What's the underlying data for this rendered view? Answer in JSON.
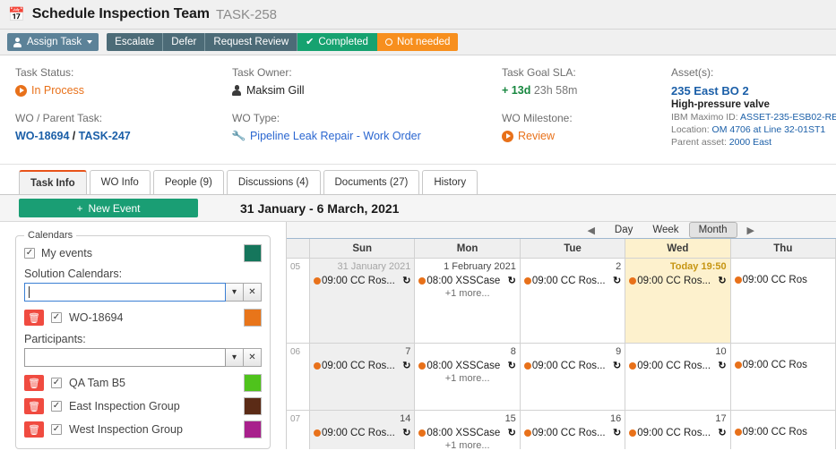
{
  "titlebar": {
    "icon": "calendar-icon",
    "title": "Schedule Inspection Team",
    "code": "TASK-258"
  },
  "toolbar": {
    "assign_label": "Assign Task",
    "buttons": [
      {
        "label": "Escalate",
        "style": "dark"
      },
      {
        "label": "Defer",
        "style": "dark"
      },
      {
        "label": "Request Review",
        "style": "dark"
      },
      {
        "label": "Completed",
        "style": "completed",
        "icon": "check-icon"
      },
      {
        "label": "Not needed",
        "style": "notneeded",
        "icon": "circle-icon"
      }
    ]
  },
  "info": {
    "task_status_label": "Task Status:",
    "task_status_value": "In Process",
    "wo_parent_label": "WO / Parent Task:",
    "wo_link": "WO-18694",
    "wo_sep": "/",
    "parent_link": "TASK-247",
    "task_owner_label": "Task Owner:",
    "task_owner_value": "Maksim Gill",
    "wo_type_label": "WO Type:",
    "wo_type_value": "Pipeline Leak Repair - Work Order",
    "sla_label": "Task Goal SLA:",
    "sla_plus": "+",
    "sla_days": "13d",
    "sla_rest": "23h 58m",
    "milestone_label": "WO Milestone:",
    "milestone_value": "Review",
    "assets_label": "Asset(s):",
    "asset_name": "235 East BO 2",
    "asset_desc": "High-pressure valve",
    "maximo_prefix": "IBM Maximo ID:",
    "maximo_id": "ASSET-235-ESB02-RE",
    "location_prefix": "Location:",
    "location_value": "OM 4706 at Line 32-01ST1",
    "parent_prefix": "Parent asset:",
    "parent_value": "2000 East"
  },
  "tabs": [
    {
      "label": "Task Info",
      "active": true
    },
    {
      "label": "WO Info",
      "active": false
    },
    {
      "label": "People (9)",
      "active": false
    },
    {
      "label": "Discussions (4)",
      "active": false
    },
    {
      "label": "Documents (27)",
      "active": false
    },
    {
      "label": "History",
      "active": false
    }
  ],
  "calbar": {
    "new_event_label": "New Event",
    "new_event_plus": "+",
    "date_range": "31 January - 6 March, 2021"
  },
  "sidebar": {
    "legend": "Calendars",
    "my_events_label": "My events",
    "my_events_checked": true,
    "my_events_color": "#15765c",
    "solution_label": "Solution Calendars:",
    "solution_value": "",
    "participants_label": "Participants:",
    "participants_value": "",
    "dropdown_glyph": "⌄",
    "clear_glyph": "✕",
    "trash_glyph": "Ὕ1",
    "calendars": [
      {
        "label": "WO-18694",
        "checked": true,
        "color": "#e8751a"
      }
    ],
    "participants": [
      {
        "label": "QA Tam B5",
        "checked": true,
        "color": "#4fc31c"
      },
      {
        "label": "East Inspection Group",
        "checked": true,
        "color": "#5b2b16"
      },
      {
        "label": "West Inspection Group",
        "checked": true,
        "color": "#a8208c"
      }
    ]
  },
  "calendar_nav": {
    "prev_glyph": "◀",
    "next_glyph": "▶",
    "views": [
      {
        "label": "Day",
        "selected": false
      },
      {
        "label": "Week",
        "selected": false
      },
      {
        "label": "Month",
        "selected": true
      }
    ]
  },
  "calendar": {
    "day_headers": [
      "Sun",
      "Mon",
      "Tue",
      "Wed",
      "Thu"
    ],
    "today_column_index": 3,
    "weeks": [
      {
        "week_number": "05",
        "days": [
          {
            "date_label": "31 January 2021",
            "muted": true,
            "weekend": true,
            "today": false,
            "events": [
              {
                "time": "09:00",
                "title": "CC Ros...",
                "recurring": true,
                "color": "#e8711a"
              }
            ],
            "more": null
          },
          {
            "date_label": "1 February 2021",
            "muted": false,
            "weekend": false,
            "today": false,
            "events": [
              {
                "time": "08:00",
                "title": "XSSCase",
                "recurring": true,
                "color": "#e8711a"
              }
            ],
            "more": "+1 more..."
          },
          {
            "date_label": "2",
            "muted": false,
            "weekend": false,
            "today": false,
            "events": [
              {
                "time": "09:00",
                "title": "CC Ros...",
                "recurring": true,
                "color": "#e8711a"
              }
            ],
            "more": null
          },
          {
            "date_label": "Today 19:50",
            "muted": false,
            "weekend": false,
            "today": true,
            "events": [
              {
                "time": "09:00",
                "title": "CC Ros...",
                "recurring": true,
                "color": "#e8711a"
              }
            ],
            "more": null
          },
          {
            "date_label": "",
            "muted": false,
            "weekend": false,
            "today": false,
            "events": [
              {
                "time": "09:00",
                "title": "CC Ros",
                "recurring": false,
                "color": "#e8711a"
              }
            ],
            "more": null
          }
        ]
      },
      {
        "week_number": "06",
        "days": [
          {
            "date_label": "7",
            "muted": false,
            "weekend": true,
            "today": false,
            "events": [
              {
                "time": "09:00",
                "title": "CC Ros...",
                "recurring": true,
                "color": "#e8711a"
              }
            ],
            "more": null
          },
          {
            "date_label": "8",
            "muted": false,
            "weekend": false,
            "today": false,
            "events": [
              {
                "time": "08:00",
                "title": "XSSCase",
                "recurring": true,
                "color": "#e8711a"
              }
            ],
            "more": "+1 more..."
          },
          {
            "date_label": "9",
            "muted": false,
            "weekend": false,
            "today": false,
            "events": [
              {
                "time": "09:00",
                "title": "CC Ros...",
                "recurring": true,
                "color": "#e8711a"
              }
            ],
            "more": null
          },
          {
            "date_label": "10",
            "muted": false,
            "weekend": false,
            "today": false,
            "events": [
              {
                "time": "09:00",
                "title": "CC Ros...",
                "recurring": true,
                "color": "#e8711a"
              }
            ],
            "more": null
          },
          {
            "date_label": "",
            "muted": false,
            "weekend": false,
            "today": false,
            "events": [
              {
                "time": "09:00",
                "title": "CC Ros",
                "recurring": false,
                "color": "#e8711a"
              }
            ],
            "more": null
          }
        ]
      },
      {
        "week_number": "07",
        "days": [
          {
            "date_label": "14",
            "muted": false,
            "weekend": true,
            "today": false,
            "events": [
              {
                "time": "09:00",
                "title": "CC Ros...",
                "recurring": true,
                "color": "#e8711a"
              }
            ],
            "more": null
          },
          {
            "date_label": "15",
            "muted": false,
            "weekend": false,
            "today": false,
            "events": [
              {
                "time": "08:00",
                "title": "XSSCase",
                "recurring": true,
                "color": "#e8711a"
              }
            ],
            "more": "+1 more..."
          },
          {
            "date_label": "16",
            "muted": false,
            "weekend": false,
            "today": false,
            "events": [
              {
                "time": "09:00",
                "title": "CC Ros...",
                "recurring": true,
                "color": "#e8711a"
              }
            ],
            "more": null
          },
          {
            "date_label": "17",
            "muted": false,
            "weekend": false,
            "today": false,
            "events": [
              {
                "time": "09:00",
                "title": "CC Ros...",
                "recurring": true,
                "color": "#e8711a"
              }
            ],
            "more": null
          },
          {
            "date_label": "",
            "muted": false,
            "weekend": false,
            "today": false,
            "events": [
              {
                "time": "09:00",
                "title": "CC Ros",
                "recurring": false,
                "color": "#e8711a"
              }
            ],
            "more": null
          }
        ]
      }
    ]
  }
}
